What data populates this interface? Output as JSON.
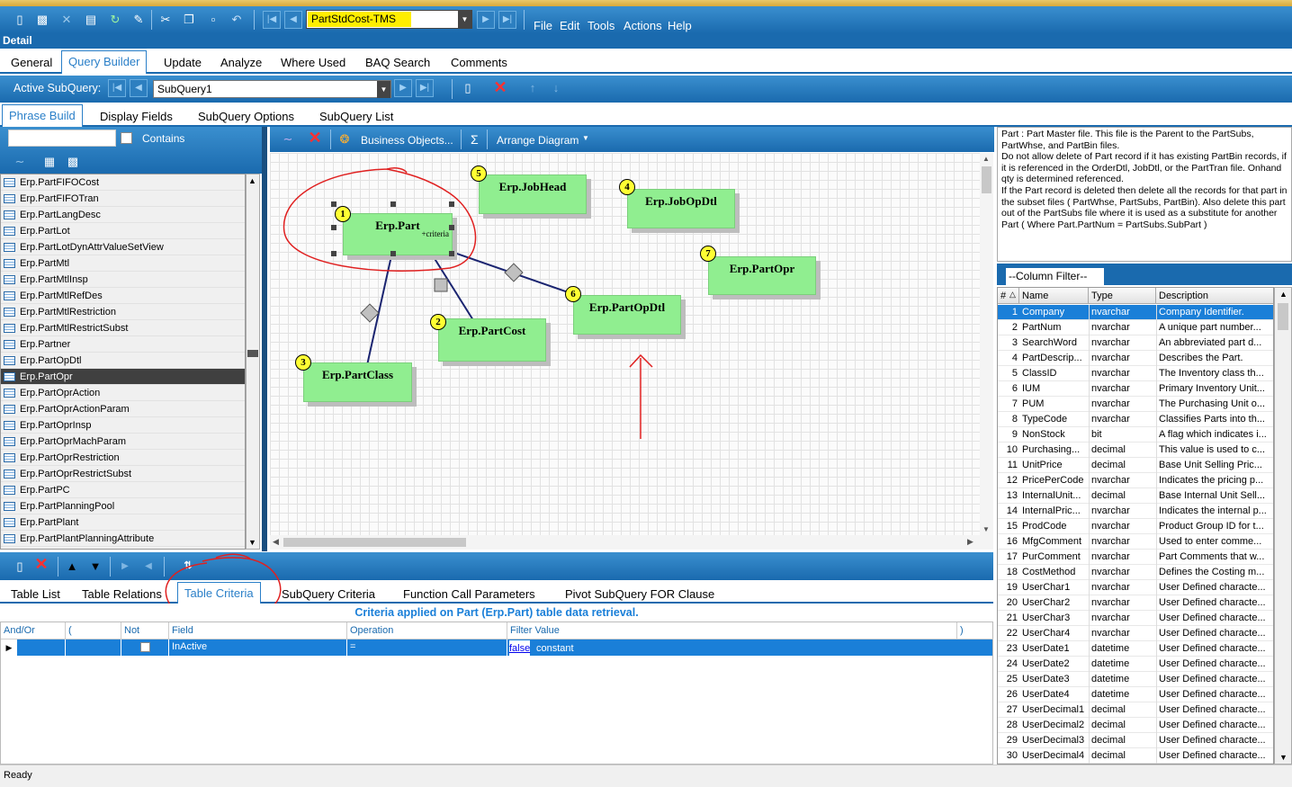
{
  "toolbar": {
    "current_query": "PartStdCost-TMS",
    "menus": [
      "File",
      "Edit",
      "Tools",
      "Actions",
      "Help"
    ]
  },
  "detail_title": "Detail",
  "main_tabs": [
    "General",
    "Query Builder",
    "Update",
    "Analyze",
    "Where Used",
    "BAQ Search",
    "Comments"
  ],
  "subquery": {
    "label": "Active SubQuery:",
    "value": "SubQuery1"
  },
  "sub_tabs": [
    "Phrase Build",
    "Display Fields",
    "SubQuery Options",
    "SubQuery List"
  ],
  "filter": {
    "contains_label": "Contains"
  },
  "table_list": [
    "Erp.PartFIFOCost",
    "Erp.PartFIFOTran",
    "Erp.PartLangDesc",
    "Erp.PartLot",
    "Erp.PartLotDynAttrValueSetView",
    "Erp.PartMtl",
    "Erp.PartMtlInsp",
    "Erp.PartMtlRefDes",
    "Erp.PartMtlRestriction",
    "Erp.PartMtlRestrictSubst",
    "Erp.Partner",
    "Erp.PartOpDtl",
    "Erp.PartOpr",
    "Erp.PartOprAction",
    "Erp.PartOprActionParam",
    "Erp.PartOprInsp",
    "Erp.PartOprMachParam",
    "Erp.PartOprRestriction",
    "Erp.PartOprRestrictSubst",
    "Erp.PartPC",
    "Erp.PartPlanningPool",
    "Erp.PartPlant",
    "Erp.PartPlantPlanningAttribute"
  ],
  "selected_table": "Erp.PartOpr",
  "diagram_toolbar": {
    "business_objects": "Business Objects...",
    "sigma": "Σ",
    "arrange": "Arrange Diagram"
  },
  "diagram_nodes": [
    {
      "num": "1",
      "name": "Erp.Part",
      "sub": "+criteria"
    },
    {
      "num": "2",
      "name": "Erp.PartCost",
      "sub": ""
    },
    {
      "num": "3",
      "name": "Erp.PartClass",
      "sub": ""
    },
    {
      "num": "4",
      "name": "Erp.JobOpDtl",
      "sub": ""
    },
    {
      "num": "5",
      "name": "Erp.JobHead",
      "sub": ""
    },
    {
      "num": "6",
      "name": "Erp.PartOpDtl",
      "sub": ""
    },
    {
      "num": "7",
      "name": "Erp.PartOpr",
      "sub": ""
    }
  ],
  "description": "Part : Part Master file. This file is the Parent to the PartSubs, PartWhse, and PartBin files.\nDo not allow delete of Part record if it has existing PartBin records, if it is referenced in the OrderDtl, JobDtl, or the PartTran file.  Onhand qty is determined referenced.\nIf the Part record is deleted then delete all the records for that part in the subset files ( PartWhse, PartSubs, PartBin). Also delete this part out of the PartSubs file where it is used as a substitute for another Part ( Where Part.PartNum = PartSubs.SubPart )",
  "column_filter": "--Column Filter--",
  "column_headers": [
    "#",
    "Name",
    "Type",
    "Description"
  ],
  "columns": [
    {
      "n": "1",
      "name": "Company",
      "type": "nvarchar",
      "desc": "Company Identifier."
    },
    {
      "n": "2",
      "name": "PartNum",
      "type": "nvarchar",
      "desc": "A unique part number..."
    },
    {
      "n": "3",
      "name": "SearchWord",
      "type": "nvarchar",
      "desc": "An abbreviated part d..."
    },
    {
      "n": "4",
      "name": "PartDescrip...",
      "type": "nvarchar",
      "desc": "Describes the Part."
    },
    {
      "n": "5",
      "name": "ClassID",
      "type": "nvarchar",
      "desc": "The Inventory class th..."
    },
    {
      "n": "6",
      "name": "IUM",
      "type": "nvarchar",
      "desc": "Primary Inventory Unit..."
    },
    {
      "n": "7",
      "name": "PUM",
      "type": "nvarchar",
      "desc": "The Purchasing Unit o..."
    },
    {
      "n": "8",
      "name": "TypeCode",
      "type": "nvarchar",
      "desc": "Classifies Parts into th..."
    },
    {
      "n": "9",
      "name": "NonStock",
      "type": "bit",
      "desc": "A flag which indicates i..."
    },
    {
      "n": "10",
      "name": "Purchasing...",
      "type": "decimal",
      "desc": "This value is used to c..."
    },
    {
      "n": "11",
      "name": "UnitPrice",
      "type": "decimal",
      "desc": "Base Unit Selling Pric..."
    },
    {
      "n": "12",
      "name": "PricePerCode",
      "type": "nvarchar",
      "desc": "Indicates the pricing p..."
    },
    {
      "n": "13",
      "name": "InternalUnit...",
      "type": "decimal",
      "desc": "Base Internal Unit Sell..."
    },
    {
      "n": "14",
      "name": "InternalPric...",
      "type": "nvarchar",
      "desc": "Indicates the internal p..."
    },
    {
      "n": "15",
      "name": "ProdCode",
      "type": "nvarchar",
      "desc": "Product Group ID for t..."
    },
    {
      "n": "16",
      "name": "MfgComment",
      "type": "nvarchar",
      "desc": "Used to enter comme..."
    },
    {
      "n": "17",
      "name": "PurComment",
      "type": "nvarchar",
      "desc": "Part Comments that w..."
    },
    {
      "n": "18",
      "name": "CostMethod",
      "type": "nvarchar",
      "desc": "Defines the Costing m..."
    },
    {
      "n": "19",
      "name": "UserChar1",
      "type": "nvarchar",
      "desc": "User Defined characte..."
    },
    {
      "n": "20",
      "name": "UserChar2",
      "type": "nvarchar",
      "desc": "User Defined characte..."
    },
    {
      "n": "21",
      "name": "UserChar3",
      "type": "nvarchar",
      "desc": "User Defined characte..."
    },
    {
      "n": "22",
      "name": "UserChar4",
      "type": "nvarchar",
      "desc": "User Defined characte..."
    },
    {
      "n": "23",
      "name": "UserDate1",
      "type": "datetime",
      "desc": "User Defined characte..."
    },
    {
      "n": "24",
      "name": "UserDate2",
      "type": "datetime",
      "desc": "User Defined characte..."
    },
    {
      "n": "25",
      "name": "UserDate3",
      "type": "datetime",
      "desc": "User Defined characte..."
    },
    {
      "n": "26",
      "name": "UserDate4",
      "type": "datetime",
      "desc": "User Defined characte..."
    },
    {
      "n": "27",
      "name": "UserDecimal1",
      "type": "decimal",
      "desc": "User Defined characte..."
    },
    {
      "n": "28",
      "name": "UserDecimal2",
      "type": "decimal",
      "desc": "User Defined characte..."
    },
    {
      "n": "29",
      "name": "UserDecimal3",
      "type": "decimal",
      "desc": "User Defined characte..."
    },
    {
      "n": "30",
      "name": "UserDecimal4",
      "type": "decimal",
      "desc": "User Defined characte..."
    }
  ],
  "bottom_tabs": [
    "Table List",
    "Table Relations",
    "Table Criteria",
    "SubQuery Criteria",
    "Function Call Parameters",
    "Pivot SubQuery FOR Clause"
  ],
  "criteria_header": "Criteria applied on Part (Erp.Part)  table data retrieval.",
  "criteria_columns": [
    "And/Or",
    "(",
    "Not",
    "Field",
    "Operation",
    "Filter Value",
    ")"
  ],
  "criteria_row": {
    "field": "InActive",
    "operation": "=",
    "filter_link": "false",
    "filter_type": "constant"
  },
  "status": "Ready",
  "colors": {
    "toolbar_blue": "#1a6aae",
    "node_green": "#90ee90",
    "badge_yellow": "#ffff33",
    "annotation_red": "#e02020",
    "selection_blue": "#1a7fd8"
  }
}
